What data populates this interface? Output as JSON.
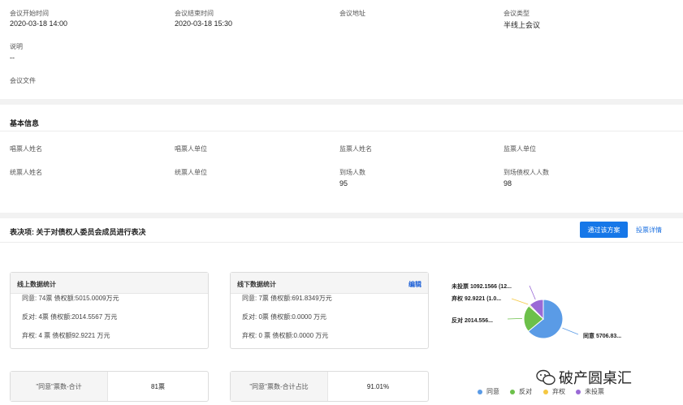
{
  "meeting": {
    "start_label": "会议开始时间",
    "start_value": "2020-03-18 14:00",
    "end_label": "会议结束时间",
    "end_value": "2020-03-18 15:30",
    "address_label": "会议地址",
    "type_label": "会议类型",
    "type_value": "半线上会议",
    "desc_label": "说明",
    "desc_value": "--",
    "file_label": "会议文件"
  },
  "basic": {
    "title": "基本信息",
    "fields": {
      "caller_name": "唱票人姓名",
      "caller_unit": "唱票人单位",
      "supervisor_name": "监票人姓名",
      "supervisor_unit": "监票人单位",
      "counter_name": "统票人姓名",
      "counter_unit": "统票人单位",
      "attendees_label": "到场人数",
      "attendees_value": "95",
      "creditor_attendees_label": "到场债权人人数",
      "creditor_attendees_value": "98"
    }
  },
  "resolution": {
    "title": "表决项: 关于对债权人委员会成员进行表决",
    "pass_button": "通过该方案",
    "detail_link": "投票详情"
  },
  "online_card": {
    "title": "线上数据统计",
    "agree": "同意: 74票 债权额:5015.0009万元",
    "oppose": "反对: 4票 债权额:2014.5567 万元",
    "abstain": "弃权: 4 票 债权额92.9221 万元"
  },
  "offline_card": {
    "title": "线下数据统计",
    "edit": "编辑",
    "agree": "同意: 7票 债权额:691.8349万元",
    "oppose": "反对: 0票 债权额:0.0000 万元",
    "abstain": "弃权: 0 票 债权额:0.0000 万元"
  },
  "summary": {
    "total_label": "\"同意\"票数-合计",
    "total_value": "81票",
    "ratio_label": "\"同意\"票数-合计占比",
    "ratio_value": "91.01%"
  },
  "chart_data": {
    "type": "pie",
    "slices": [
      {
        "name": "同意",
        "value": 5706.83,
        "label": "同意 5706.83...",
        "color": "#5a9be6"
      },
      {
        "name": "反对",
        "value": 2014.556,
        "label": "反对 2014.556...",
        "color": "#6cc04a"
      },
      {
        "name": "弃权",
        "value": 92.9221,
        "label": "弃权 92.9221 (1.0...",
        "color": "#f5c842"
      },
      {
        "name": "未投票",
        "value": 1092.1566,
        "label": "未投票 1092.1566 (12...",
        "color": "#9a6ad6"
      }
    ],
    "legend": [
      "同意",
      "反对",
      "弃权",
      "未投票"
    ],
    "legend_position": "bottom"
  },
  "watermark": "破产圆桌汇"
}
